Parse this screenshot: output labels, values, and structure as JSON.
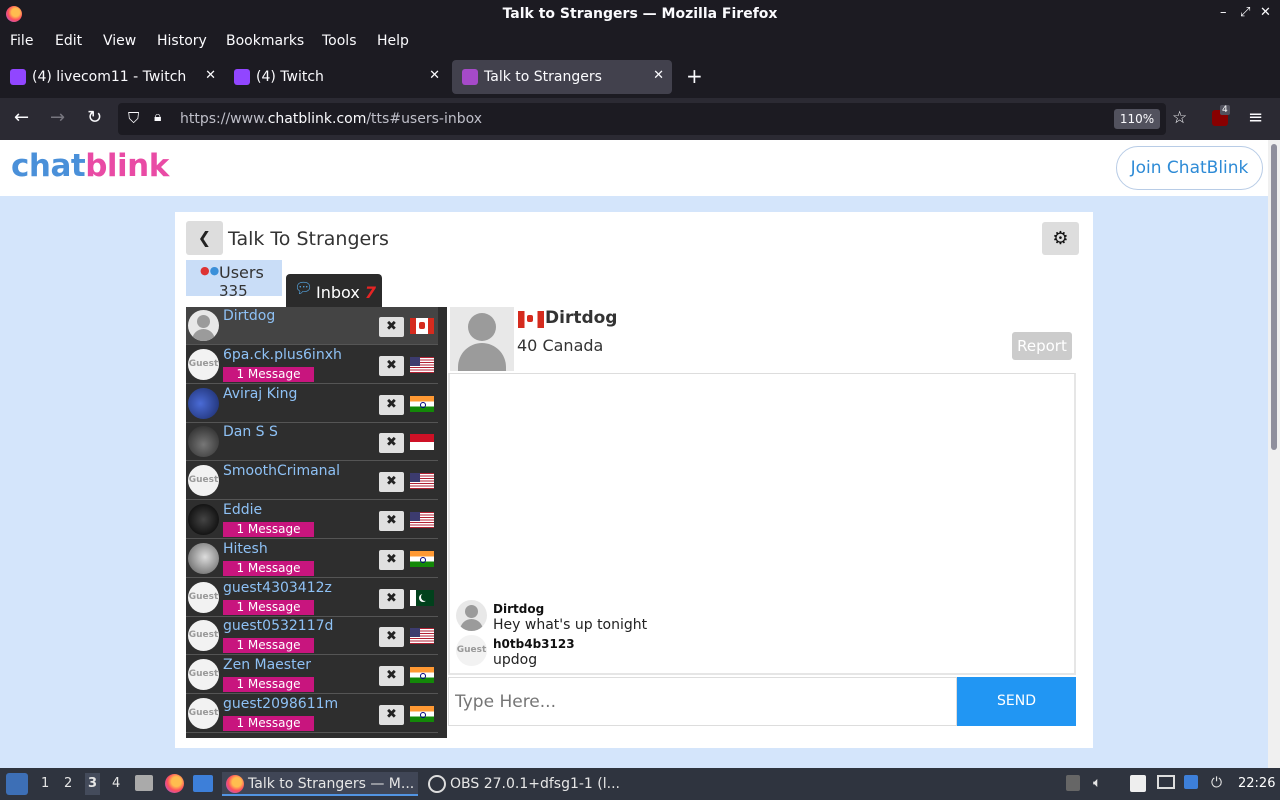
{
  "window": {
    "title": "Talk to Strangers — Mozilla Firefox",
    "controls": [
      "–",
      "⤢",
      "✕"
    ]
  },
  "menu": [
    "File",
    "Edit",
    "View",
    "History",
    "Bookmarks",
    "Tools",
    "Help"
  ],
  "tabs": [
    {
      "label": "(4) livecom11 - Twitch",
      "icon_color": "#9146ff"
    },
    {
      "label": "(4) Twitch",
      "icon_color": "#9146ff"
    },
    {
      "label": "Talk to Strangers",
      "icon_color": "#a64ac9",
      "active": true
    }
  ],
  "navbar": {
    "url_prefix": "https://www.",
    "url_domain": "chatblink.com",
    "url_suffix": "/tts#users-inbox",
    "zoom": "110%",
    "extension_badge": "4"
  },
  "site": {
    "logo_a": "chat",
    "logo_b": "blink",
    "join_label": "Join ChatBlink"
  },
  "card": {
    "title": "Talk To Strangers",
    "users_tab": "Users",
    "users_count": "335",
    "inbox_tab": "Inbox",
    "inbox_unread": "7"
  },
  "users": [
    {
      "name": "Dirtdog",
      "avatar": "default",
      "badge": "",
      "flag": "ca",
      "selected": true
    },
    {
      "name": "6pa.ck.plus6inxh",
      "avatar": "guest",
      "badge": "1 Message",
      "flag": "us"
    },
    {
      "name": "Aviraj King",
      "avatar": "photo1",
      "badge": "",
      "flag": "in"
    },
    {
      "name": "Dan S S",
      "avatar": "photo2",
      "badge": "",
      "flag": "id"
    },
    {
      "name": "SmoothCrimanal",
      "avatar": "guest",
      "badge": "",
      "flag": "us"
    },
    {
      "name": "Eddie",
      "avatar": "photo3",
      "badge": "1 Message",
      "flag": "us"
    },
    {
      "name": "Hitesh",
      "avatar": "photo4",
      "badge": "1 Message",
      "flag": "in"
    },
    {
      "name": "guest4303412z",
      "avatar": "guest",
      "badge": "1 Message",
      "flag": "pk"
    },
    {
      "name": "guest0532117d",
      "avatar": "guest",
      "badge": "1 Message",
      "flag": "us"
    },
    {
      "name": "Zen Maester",
      "avatar": "guest",
      "badge": "1 Message",
      "flag": "in"
    },
    {
      "name": "guest2098611m",
      "avatar": "guest",
      "badge": "1 Message",
      "flag": "in"
    }
  ],
  "guest_label": "Guest",
  "profile": {
    "name": "Dirtdog",
    "info": "40 Canada",
    "report_label": "Report"
  },
  "messages": [
    {
      "sender": "Dirtdog",
      "text": "Hey what's up tonight",
      "avatar": "default"
    },
    {
      "sender": "h0tb4b3123",
      "text": "updog",
      "avatar": "guest"
    }
  ],
  "compose": {
    "placeholder": "Type Here...",
    "send_label": "SEND"
  },
  "taskbar": {
    "workspaces": [
      "1",
      "2",
      "3",
      "4"
    ],
    "active_workspace": "3",
    "items": [
      {
        "label": "Talk to Strangers — M...",
        "active": true
      },
      {
        "label": "OBS 27.0.1+dfsg1-1 (l...",
        "active": false
      }
    ],
    "clock": "22:26"
  }
}
